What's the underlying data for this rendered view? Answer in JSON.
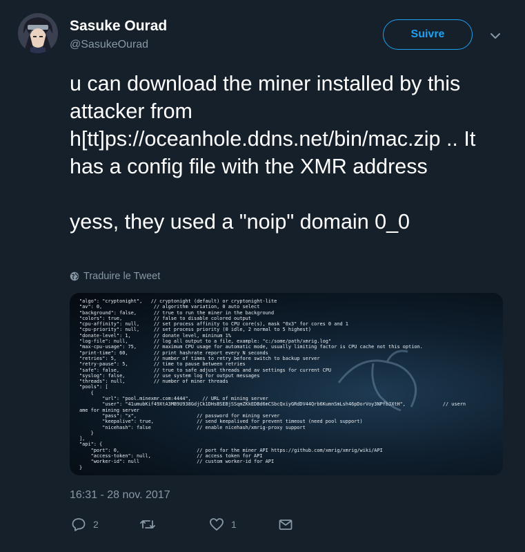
{
  "author": {
    "name": "Sasuke Ourad",
    "handle": "@SasukeOurad"
  },
  "follow_label": "Suivre",
  "tweet_text": "u can download the miner installed by this attacker from h[tt]ps://oceanhole.ddns.net/bin/mac.zip .. It has a config file with the XMR address\n\nyess, they used a \"noip\" domain 0_0",
  "translate_label": "Traduire le Tweet",
  "media_code": "\"algo\": \"cryptonight\",   // cryptonight (default) or cryptonight-lite\n\"av\": 0,                  // algorithm variation, 0 auto select\n\"background\": false,      // true to run the miner in the background\n\"colors\": true,           // false to disable colored output\n\"cpu-affinity\": null,     // set process affinity to CPU core(s), mask \"0x3\" for cores 0 and 1\n\"cpu-priority\": null,     // set process priority (0 idle, 2 normal to 5 highest)\n\"donate-level\": 1,        // donate level, mininum 1%\n\"log-file\": null,         // log all output to a file, example: \"c:/some/path/xmrig.log\"\n\"max-cpu-usage\": 75,      // maximum CPU usage for automatic mode, usually limiting factor is CPU cache not this option.\n\"print-time\": 60,         // print hashrate report every N seconds\n\"retries\": 5,             // number of times to retry before switch to backup server\n\"retry-pause\": 5,         // time to pause between retries\n\"safe\": false,            // true to safe adjust threads and av settings for current CPU\n\"syslog\": false,          // use system log for output messages\n\"threads\": null,          // number of miner threads\n\"pools\": [\n    {\n        \"url\": \"pool.minexmr.com:4444\",    // URL of mining server\n        \"user\": \"41umubKif49XtA3MB9U938GdjCk1DHsBSEBjSSqmZKkEDBd6mCSbcQxiyGRdDV44Qrb6KumnSmLsh46pDorVoy3NPfbJXtH\",             // usern\name for mining server\n        \"pass\": \"x\",                     // password for mining server\n        \"keepalive\": true,               // send keepalived for prevent timeout (need pool support)\n        \"nicehash\": false                // enable nicehash/xmrig-proxy support\n    }\n],\n\"api\": {\n    \"port\": 0,                           // port for the miner API https://github.com/xmrig/xmrig/wiki/API\n    \"access-token\": null,                // access token for API\n    \"worker-id\": null                    // custom worker-id for API\n}",
  "timestamp": "16:31 - 28 nov. 2017",
  "actions": {
    "reply_count": "2",
    "like_count": "1"
  },
  "icons": [
    "chevron-down-icon",
    "globe-icon",
    "reply-icon",
    "retweet-icon",
    "like-icon",
    "message-icon"
  ],
  "colors": {
    "background": "#15202b",
    "accent": "#1da1f2",
    "muted": "#8899a6"
  }
}
